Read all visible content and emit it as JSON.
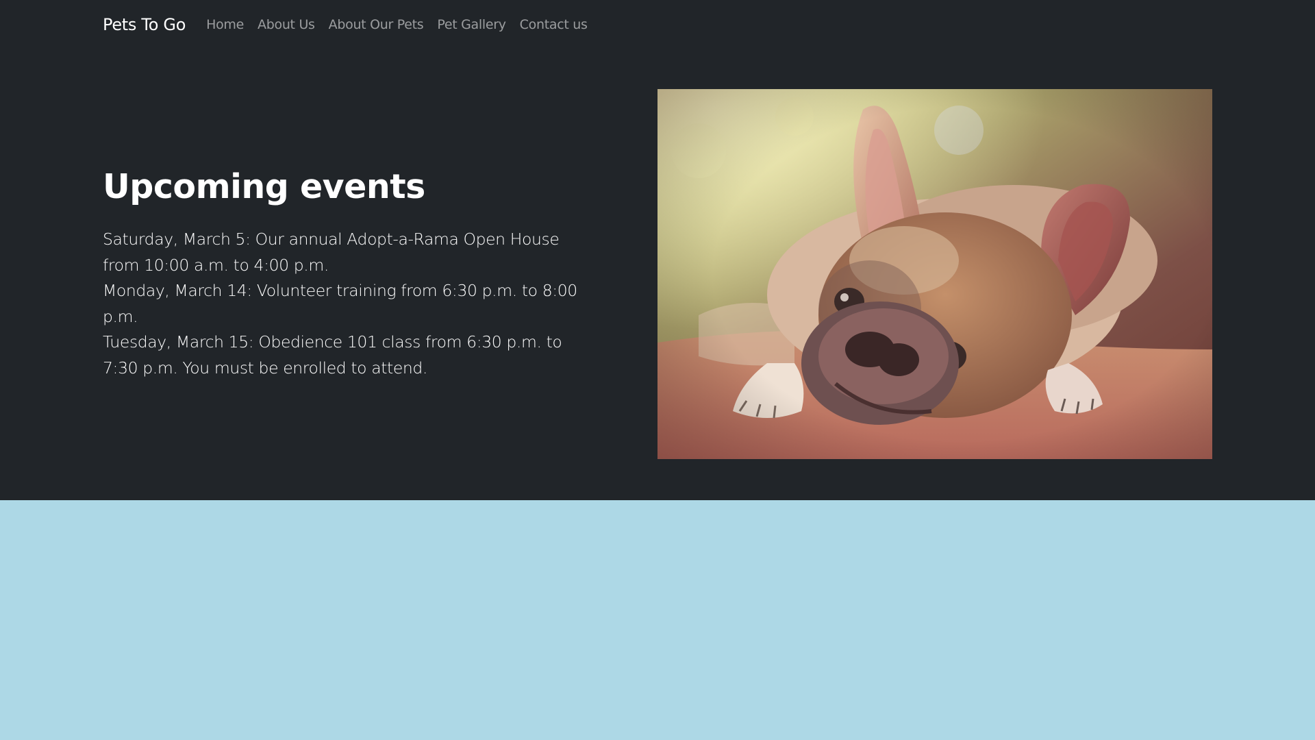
{
  "navbar": {
    "brand": "Pets To Go",
    "links": [
      {
        "label": "Home"
      },
      {
        "label": "About Us"
      },
      {
        "label": "About Our Pets"
      },
      {
        "label": "Pet Gallery"
      },
      {
        "label": "Contact us"
      }
    ]
  },
  "events": {
    "heading": "Upcoming events",
    "items": [
      "Saturday, March 5: Our annual Adopt-a-Rama Open House from 10:00 a.m. to 4:00 p.m.",
      "Monday, March 14: Volunteer training from 6:30 p.m. to 8:00 p.m.",
      "Tuesday, March 15: Obedience 101 class from 6:30 p.m. to 7:30 p.m. You must be enrolled to attend."
    ]
  },
  "hero_image": {
    "icon": "french-bulldog-photo"
  },
  "colors": {
    "header_bg": "#212529",
    "page_bg": "#add8e6",
    "nav_link": "rgba(255,255,255,0.55)",
    "text": "#ffffff"
  }
}
